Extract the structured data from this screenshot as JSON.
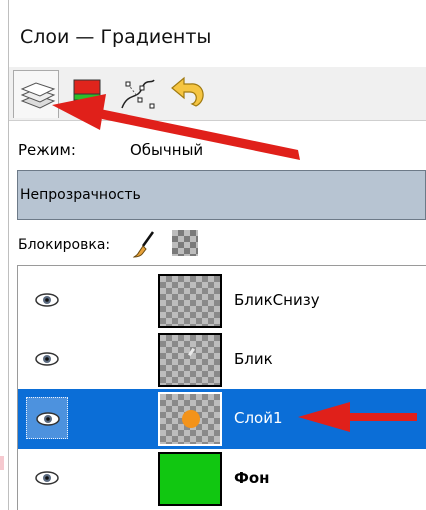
{
  "window": {
    "title": "Слои — Градиенты"
  },
  "tabs": [
    {
      "icon": "layers-icon",
      "active": true
    },
    {
      "icon": "channels-icon",
      "active": false
    },
    {
      "icon": "paths-icon",
      "active": false
    },
    {
      "icon": "undo-history-icon",
      "active": false
    }
  ],
  "mode": {
    "label": "Режим:",
    "value": "Обычный"
  },
  "opacity": {
    "label": "Непрозрачность"
  },
  "lock": {
    "label": "Блокировка:",
    "icons": [
      "brush-icon",
      "alpha-icon"
    ]
  },
  "layers": [
    {
      "name": "БликСнизу",
      "visible": true,
      "selected": false,
      "thumbnail": "transparent"
    },
    {
      "name": "Блик",
      "visible": true,
      "selected": false,
      "thumbnail": "transparent-spark"
    },
    {
      "name": "Слой1",
      "visible": true,
      "selected": true,
      "thumbnail": "orange-dot"
    },
    {
      "name": "Фон",
      "visible": true,
      "selected": false,
      "thumbnail": "green",
      "bold": true
    }
  ],
  "colors": {
    "selection": "#0b6ed7",
    "opacity_bar": "#b7c4d2",
    "annotation_arrow": "#e0201a",
    "background_layer": "#11c711",
    "dot": "#f3931a"
  }
}
